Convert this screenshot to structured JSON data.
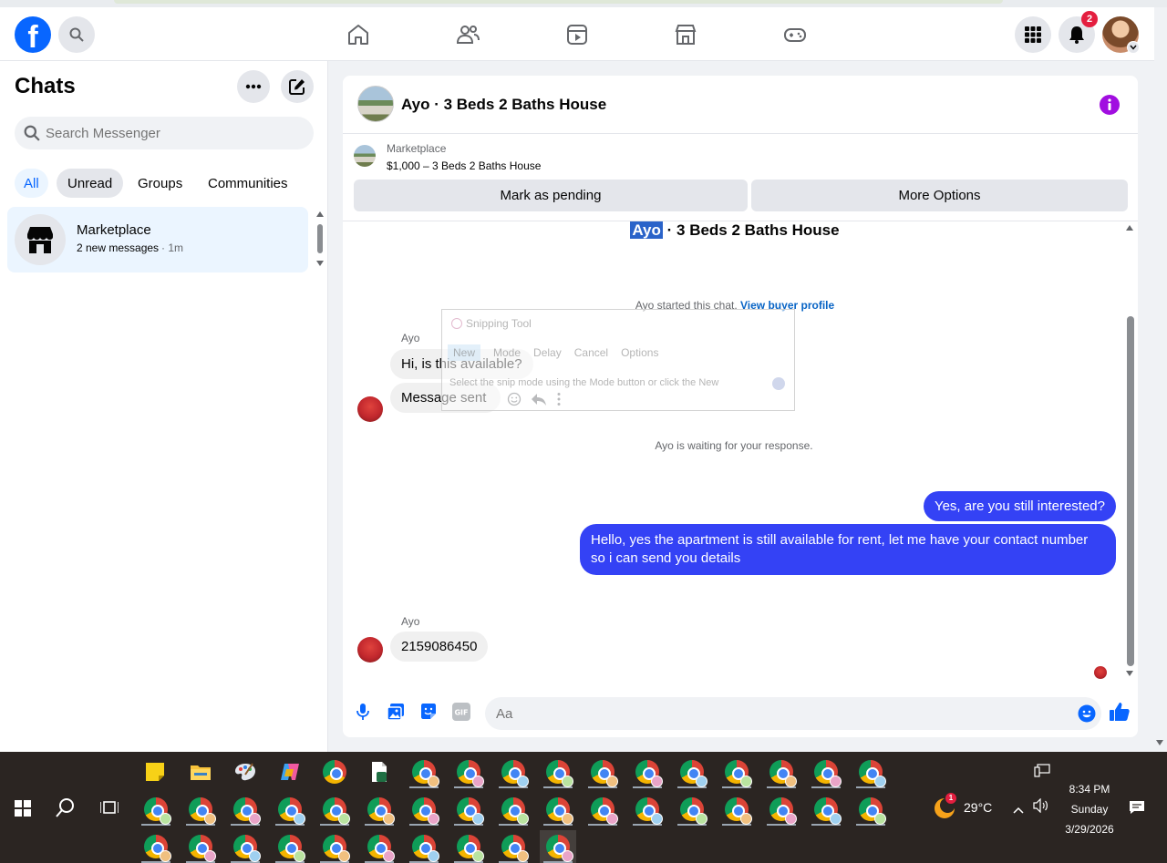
{
  "colors": {
    "accent": "#0866ff",
    "outgoing_bubble": "#3442f5",
    "badge": "#e41e3f",
    "selected_chat": "#ebf5ff"
  },
  "nav": {
    "logo_letter": "f",
    "notification_count": "2",
    "icons": [
      "home-icon",
      "friends-icon",
      "video-icon",
      "marketplace-icon",
      "gaming-icon"
    ]
  },
  "sidebar": {
    "title": "Chats",
    "search_placeholder": "Search Messenger",
    "filters": [
      "All",
      "Unread",
      "Groups",
      "Communities"
    ],
    "active_filter": "All",
    "chats": [
      {
        "name": "Marketplace",
        "preview": "2 new messages",
        "time": "· 1m"
      }
    ]
  },
  "conversation": {
    "title": "Ayo · 3 Beds 2 Baths House",
    "marketplace_label": "Marketplace",
    "listing": "$1,000 – 3 Beds 2 Baths House",
    "mark_pending_label": "Mark as pending",
    "more_options_label": "More Options",
    "heading_name": "Ayo",
    "heading_rest": " · 3 Beds 2 Baths House",
    "started_text": "Ayo started this chat.",
    "view_profile_link": "View buyer profile",
    "sender_name": "Ayo",
    "messages_in_1": [
      "Hi, is this available?",
      "Message sent"
    ],
    "waiting_text": "Ayo is waiting for your response.",
    "messages_out": [
      "Yes, are you still interested?",
      "Hello, yes the apartment is still available for rent, let me have your contact number so i can send you details"
    ],
    "sender_name_2": "Ayo",
    "messages_in_2": [
      "2159086450"
    ],
    "composer_placeholder": "Aa"
  },
  "snipping_tool": {
    "title": "Snipping Tool",
    "buttons": [
      "New",
      "Mode",
      "Delay",
      "Cancel",
      "Options"
    ],
    "hint": "Select the snip mode using the Mode button or click the New"
  },
  "taskbar": {
    "weather": "29°C",
    "time": "8:34 PM",
    "day": "Sunday",
    "date": "3/29/2026",
    "weather_badge": "1"
  }
}
